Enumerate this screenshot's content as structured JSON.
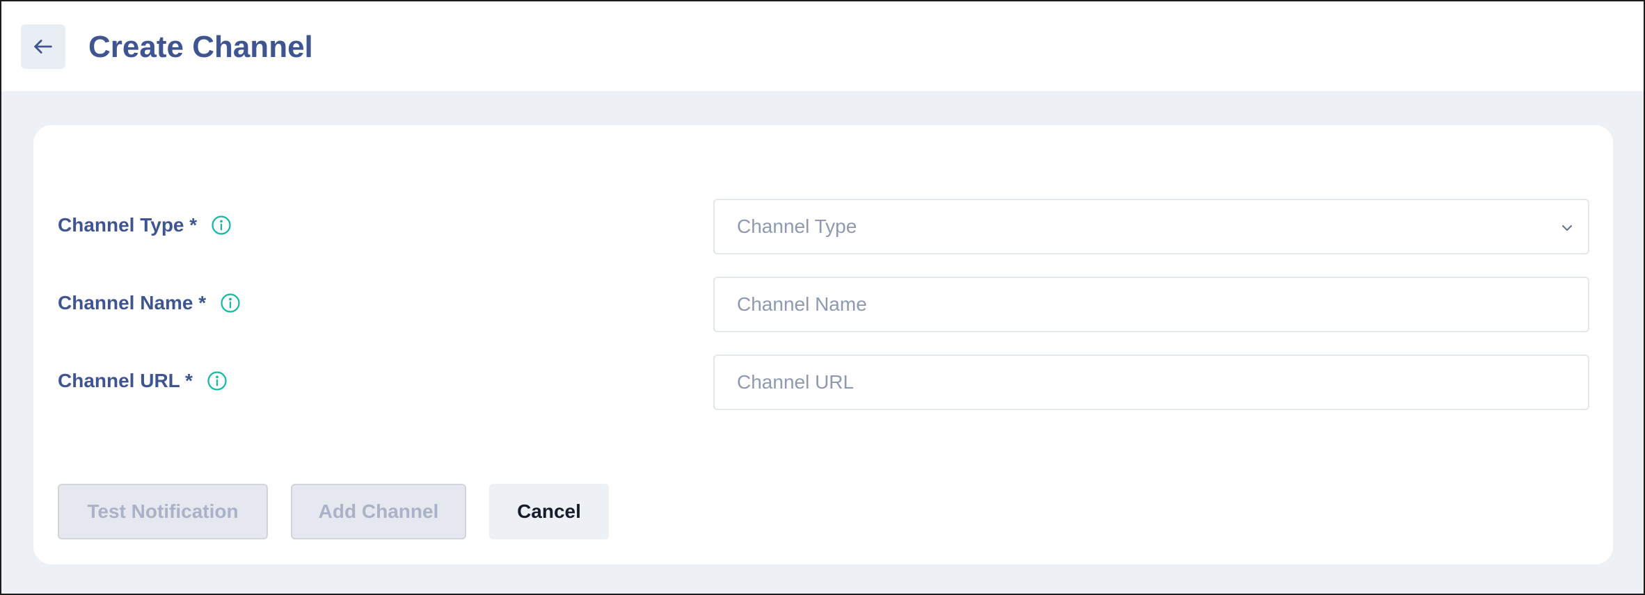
{
  "header": {
    "title": "Create Channel",
    "back_icon": "arrow-left-icon"
  },
  "form": {
    "fields": [
      {
        "label": "Channel Type *",
        "placeholder": "Channel Type",
        "kind": "select",
        "value": ""
      },
      {
        "label": "Channel Name *",
        "placeholder": "Channel Name",
        "kind": "text",
        "value": ""
      },
      {
        "label": "Channel URL *",
        "placeholder": "Channel URL",
        "kind": "text",
        "value": ""
      }
    ],
    "info_icon": "info-circle-icon"
  },
  "actions": {
    "test_label": "Test Notification",
    "add_label": "Add Channel",
    "cancel_label": "Cancel"
  },
  "colors": {
    "accent": "#3e5592",
    "info": "#14b8a6",
    "background": "#edf0f5"
  }
}
